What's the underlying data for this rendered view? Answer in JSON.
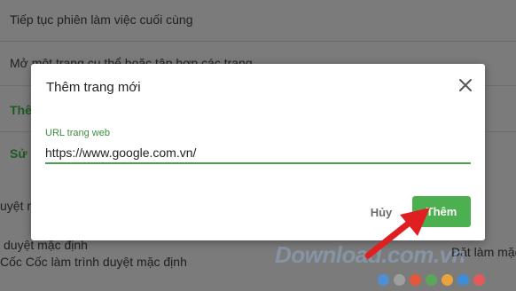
{
  "background": {
    "line1": "Tiếp tục phiên làm việc cuối cùng",
    "line2": "Mở một trang cụ thể hoặc tập hợp các trang",
    "line3": "Thêm",
    "line4": "Sử d",
    "line5": "uyệt mặ",
    "line6": "duyệt mặc định",
    "line7": "Cốc Cốc làm trình duyệt mặc định",
    "line8": "Đặt làm mặc"
  },
  "watermark": {
    "text": "Download.com.vn",
    "dot_colors": [
      "#4f8fd3",
      "#9e9e9e",
      "#e5563d",
      "#5aa757",
      "#e8a33c",
      "#3f8cd8",
      "#e45a5a"
    ]
  },
  "dialog": {
    "title": "Thêm trang mới",
    "close_icon": "close-icon",
    "url_label": "URL trang web",
    "url_value": "https://www.google.com.vn/",
    "cancel_label": "Hủy",
    "add_label": "Thêm"
  },
  "colors": {
    "accent": "#4caf50",
    "accent_dark": "#3c8d40",
    "arrow": "#e02020"
  }
}
